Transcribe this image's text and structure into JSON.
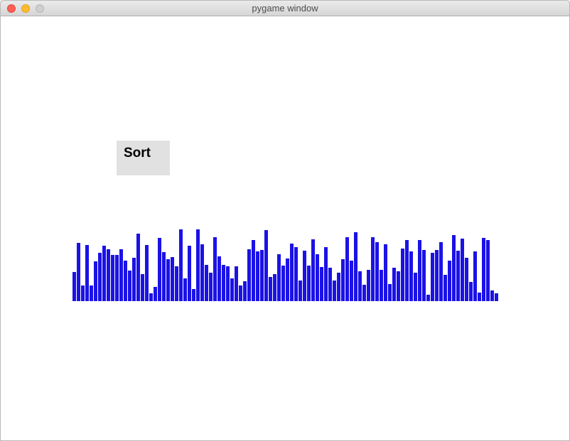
{
  "window": {
    "title": "pygame window"
  },
  "sort_button": {
    "label": "Sort",
    "background": "#e1e1e1"
  },
  "chart_data": {
    "type": "bar",
    "bar_color": "#1b12e6",
    "values": [
      41,
      82,
      22,
      79,
      22,
      56,
      68,
      78,
      73,
      65,
      65,
      73,
      57,
      43,
      61,
      95,
      38,
      79,
      11,
      20,
      89,
      69,
      59,
      62,
      49,
      101,
      32,
      78,
      17,
      101,
      80,
      51,
      40,
      90,
      63,
      51,
      49,
      32,
      49,
      22,
      28,
      73,
      86,
      70,
      72,
      100,
      34,
      38,
      66,
      50,
      60,
      81,
      76,
      29,
      71,
      50,
      87,
      66,
      48,
      76,
      47,
      29,
      40,
      59,
      90,
      57,
      97,
      42,
      23,
      44,
      90,
      83,
      44,
      80,
      24,
      47,
      42,
      74,
      86,
      70,
      40,
      86,
      72,
      9,
      68,
      72,
      83,
      37,
      57,
      93,
      71,
      88,
      61,
      27,
      70,
      12,
      89,
      86,
      15,
      11
    ],
    "ylim": [
      0,
      105
    ]
  }
}
